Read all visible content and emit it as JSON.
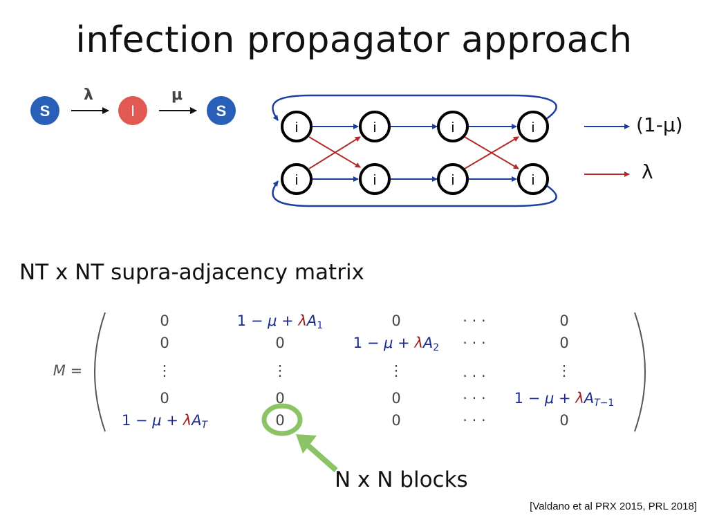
{
  "title": "infection propagator approach",
  "sis": {
    "nodes": [
      "S",
      "I",
      "S"
    ],
    "rates": [
      "λ",
      "μ"
    ],
    "colors": {
      "S": "#2a5fb8",
      "I": "#e05a52"
    }
  },
  "network": {
    "node_label": "i",
    "legend": [
      {
        "label": "(1-μ)",
        "color": "#1a3fa0"
      },
      {
        "label": "λ",
        "color": "#b22a2a"
      }
    ]
  },
  "subtitle": "NT x NT supra-adjacency matrix",
  "matrix": {
    "lhs": "M =",
    "rows": [
      [
        "0",
        "1 − μ + λA_1",
        "0",
        "· · ·",
        "0"
      ],
      [
        "0",
        "0",
        "1 − μ + λA_2",
        "· · ·",
        "0"
      ],
      [
        "⋮",
        "⋮",
        "⋮",
        "· · ·",
        "⋮"
      ],
      [
        "0",
        "0",
        "0",
        "· · ·",
        "1 − μ + λA_T−1"
      ],
      [
        "1 − μ + λA_T",
        "0",
        "0",
        "· · ·",
        "0"
      ]
    ]
  },
  "highlight_color": "#8cc465",
  "blocks_label": "N x N blocks",
  "reference": "[Valdano et al PRX 2015, PRL 2018]"
}
